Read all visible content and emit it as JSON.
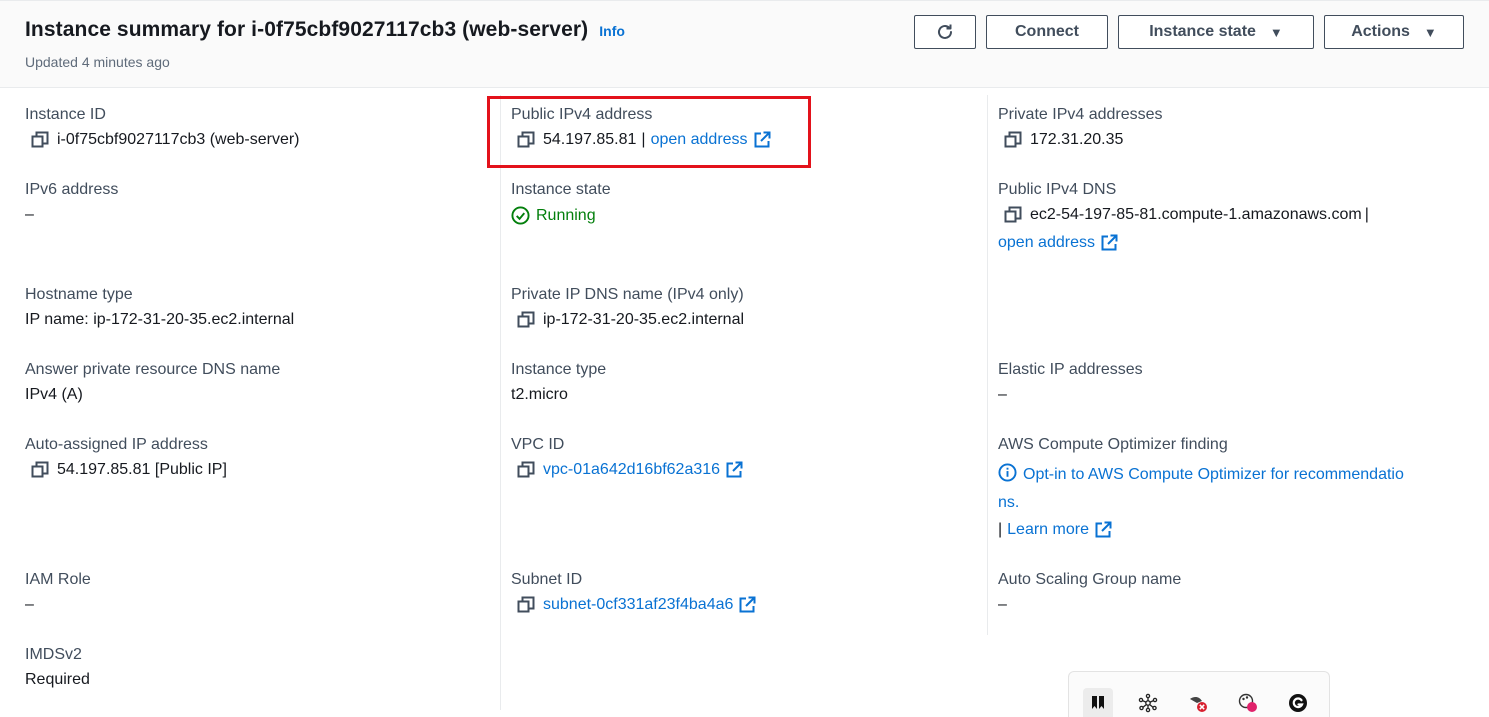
{
  "header": {
    "title": "Instance summary for i-0f75cbf9027117cb3 (web-server)",
    "info_label": "Info",
    "updated": "Updated 4 minutes ago",
    "buttons": {
      "refresh_icon": "refresh-icon",
      "connect": "Connect",
      "instance_state": "Instance state",
      "actions": "Actions"
    }
  },
  "col1": {
    "instance_id": {
      "label": "Instance ID",
      "value": "i-0f75cbf9027117cb3 (web-server)"
    },
    "ipv6": {
      "label": "IPv6 address",
      "value": "–"
    },
    "hostname_type": {
      "label": "Hostname type",
      "value": "IP name: ip-172-31-20-35.ec2.internal"
    },
    "answer_dns": {
      "label": "Answer private resource DNS name",
      "value": "IPv4 (A)"
    },
    "auto_ip": {
      "label": "Auto-assigned IP address",
      "value": "54.197.85.81 [Public IP]"
    },
    "iam_role": {
      "label": "IAM Role",
      "value": "–"
    },
    "imdsv2": {
      "label": "IMDSv2",
      "value": "Required"
    }
  },
  "col2": {
    "public_ipv4": {
      "label": "Public IPv4 address",
      "value": "54.197.85.81",
      "separator": "|",
      "link": "open address"
    },
    "instance_state": {
      "label": "Instance state",
      "value": "Running"
    },
    "private_dns": {
      "label": "Private IP DNS name (IPv4 only)",
      "value": "ip-172-31-20-35.ec2.internal"
    },
    "instance_type": {
      "label": "Instance type",
      "value": "t2.micro"
    },
    "vpc_id": {
      "label": "VPC ID",
      "value": "vpc-01a642d16bf62a316"
    },
    "subnet_id": {
      "label": "Subnet ID",
      "value": "subnet-0cf331af23f4ba4a6"
    }
  },
  "col3": {
    "private_ipv4": {
      "label": "Private IPv4 addresses",
      "value": "172.31.20.35"
    },
    "public_dns": {
      "label": "Public IPv4 DNS",
      "value": "ec2-54-197-85-81.compute-1.amazonaws.com",
      "separator": "|",
      "link": "open address"
    },
    "elastic_ip": {
      "label": "Elastic IP addresses",
      "value": "–"
    },
    "optimizer": {
      "label": "AWS Compute Optimizer finding",
      "line1": "Opt-in to AWS Compute Optimizer for recommendatio",
      "line2": "ns.",
      "separator": "|",
      "learn_more": "Learn more"
    },
    "asg": {
      "label": "Auto Scaling Group name",
      "value": "–"
    }
  },
  "colors": {
    "link": "#0972d3",
    "success": "#037f0c",
    "highlight": "#e3121b",
    "text": "#16191f",
    "label": "#414d5c"
  },
  "tray": {
    "icons": [
      "bookmark-icon",
      "network-icon",
      "blocked-icon",
      "palette-icon",
      "grammar-icon"
    ]
  }
}
